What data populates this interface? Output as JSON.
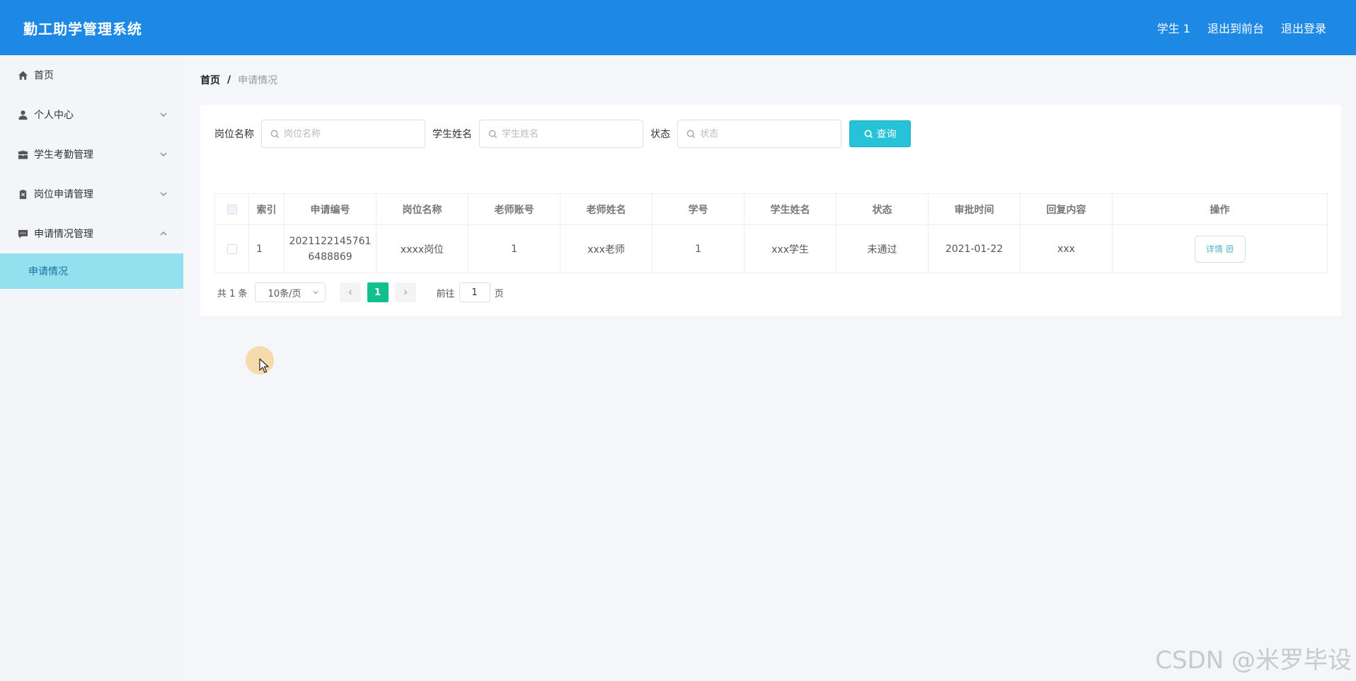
{
  "header": {
    "app_title": "勤工助学管理系统",
    "user": "学生 1",
    "to_front": "退出到前台",
    "logout": "退出登录"
  },
  "sidebar": {
    "items": [
      {
        "label": "首页",
        "icon": "home-icon"
      },
      {
        "label": "个人中心",
        "icon": "user-icon"
      },
      {
        "label": "学生考勤管理",
        "icon": "briefcase-icon"
      },
      {
        "label": "岗位申请管理",
        "icon": "clipboard-icon"
      },
      {
        "label": "申请情况管理",
        "icon": "chat-icon"
      }
    ],
    "submenu": {
      "label": "申请情况"
    }
  },
  "breadcrumb": {
    "home": "首页",
    "separator": "/",
    "current": "申请情况"
  },
  "search": {
    "job_label": "岗位名称",
    "job_placeholder": "岗位名称",
    "student_label": "学生姓名",
    "student_placeholder": "学生姓名",
    "status_label": "状态",
    "status_placeholder": "状态",
    "query_button": "查询"
  },
  "table": {
    "headers": [
      "索引",
      "申请编号",
      "岗位名称",
      "老师账号",
      "老师姓名",
      "学号",
      "学生姓名",
      "状态",
      "审批时间",
      "回复内容",
      "操作"
    ],
    "rows": [
      {
        "index": "1",
        "app_id_line1": "2021122145761",
        "app_id_line2": "6488869",
        "job": "xxxx岗位",
        "teacher_account": "1",
        "teacher_name": "xxx老师",
        "student_id": "1",
        "student_name": "xxx学生",
        "status": "未通过",
        "approval_time": "2021-01-22",
        "reply": "xxx",
        "action": "详情"
      }
    ]
  },
  "pagination": {
    "total": "共 1 条",
    "page_size": "10条/页",
    "current_page": "1",
    "goto_prefix": "前往",
    "goto_value": "1",
    "goto_suffix": "页"
  },
  "watermark": "CSDN @米罗毕设",
  "colors": {
    "header": "#1e88e5",
    "submenu_active": "#93e1ef",
    "query_button": "#25c2d8",
    "current_page": "#14bf8f"
  }
}
